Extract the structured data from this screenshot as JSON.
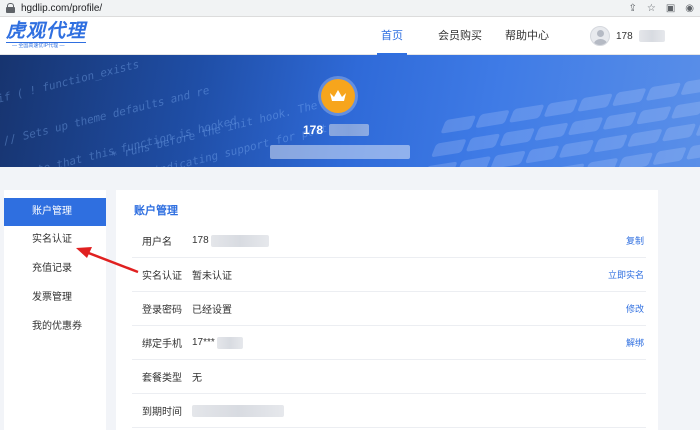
{
  "browser": {
    "url": "hgdlip.com/profile/",
    "icons": [
      "share-icon",
      "star-icon",
      "sidebar-icon",
      "profile-icon"
    ]
  },
  "header": {
    "logo_main": "虎观代理",
    "logo_sub": "— 全国高速优IP代理 —",
    "nav": [
      {
        "label": "首页",
        "active": true
      },
      {
        "label": "会员购买",
        "active": false
      },
      {
        "label": "帮助中心",
        "active": false
      }
    ],
    "user_name": "178"
  },
  "hero": {
    "code_lines": [
      "if ( ! function_exists",
      "// Sets up theme defaults and re",
      "* Note that this function is hooked",
      "* runs before the init hook. The",
      "* as indicating support for post"
    ],
    "user_name": "178"
  },
  "sidebar": {
    "items": [
      {
        "label": "账户管理",
        "active": true
      },
      {
        "label": "实名认证",
        "active": false
      },
      {
        "label": "充值记录",
        "active": false
      },
      {
        "label": "发票管理",
        "active": false
      },
      {
        "label": "我的优惠券",
        "active": false
      }
    ]
  },
  "panel": {
    "title": "账户管理",
    "rows": [
      {
        "label": "用户名",
        "value": "178",
        "action": "复制"
      },
      {
        "label": "实名认证",
        "value": "暂未认证",
        "action": "立即实名"
      },
      {
        "label": "登录密码",
        "value": "已经设置",
        "action": "修改"
      },
      {
        "label": "绑定手机",
        "value": "17***",
        "action": "解绑"
      },
      {
        "label": "套餐类型",
        "value": "无",
        "action": ""
      },
      {
        "label": "到期时间",
        "value": "",
        "action": ""
      }
    ]
  },
  "colors": {
    "brand": "#2f6fe0",
    "crown": "#f7a51c",
    "annotation_arrow": "#e02020"
  }
}
